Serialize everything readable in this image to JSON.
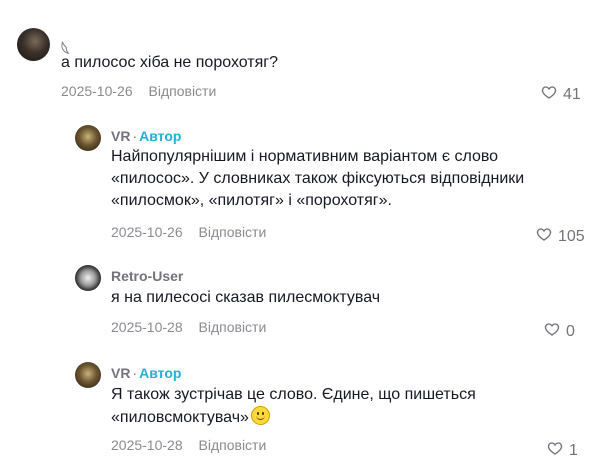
{
  "comments": [
    {
      "author": "𓆩",
      "badge": "",
      "text": "а пилосос хіба не порохотяг?",
      "date": "2025-10-26",
      "reply": "Відповісти",
      "likes": "41"
    },
    {
      "author": "VR",
      "badge": "Автор",
      "text": "Найпопулярнішим і нормативним варіантом є слово «пилосос». У словниках також фіксуються відповідники «пилосмок», «пилотяг» і «порохотяг».",
      "date": "2025-10-26",
      "reply": "Відповісти",
      "likes": "105"
    },
    {
      "author": "Retro-User",
      "badge": "",
      "text": "я на пилесосі сказав пилесмоктувач",
      "date": "2025-10-28",
      "reply": "Відповісти",
      "likes": "0"
    },
    {
      "author": "VR",
      "badge": "Автор",
      "text": "Я також зустрічав це слово. Єдине, що пишеться «пиловсмоктувач»",
      "date": "2025-10-28",
      "reply": "Відповісти",
      "likes": "1"
    }
  ],
  "separator": "·",
  "icons": {
    "like": "heart-outline-icon",
    "emoji": "smiling-face-icon"
  },
  "colors": {
    "badge": "#20b0d8",
    "meta": "#8a8b91",
    "text": "#161823"
  }
}
